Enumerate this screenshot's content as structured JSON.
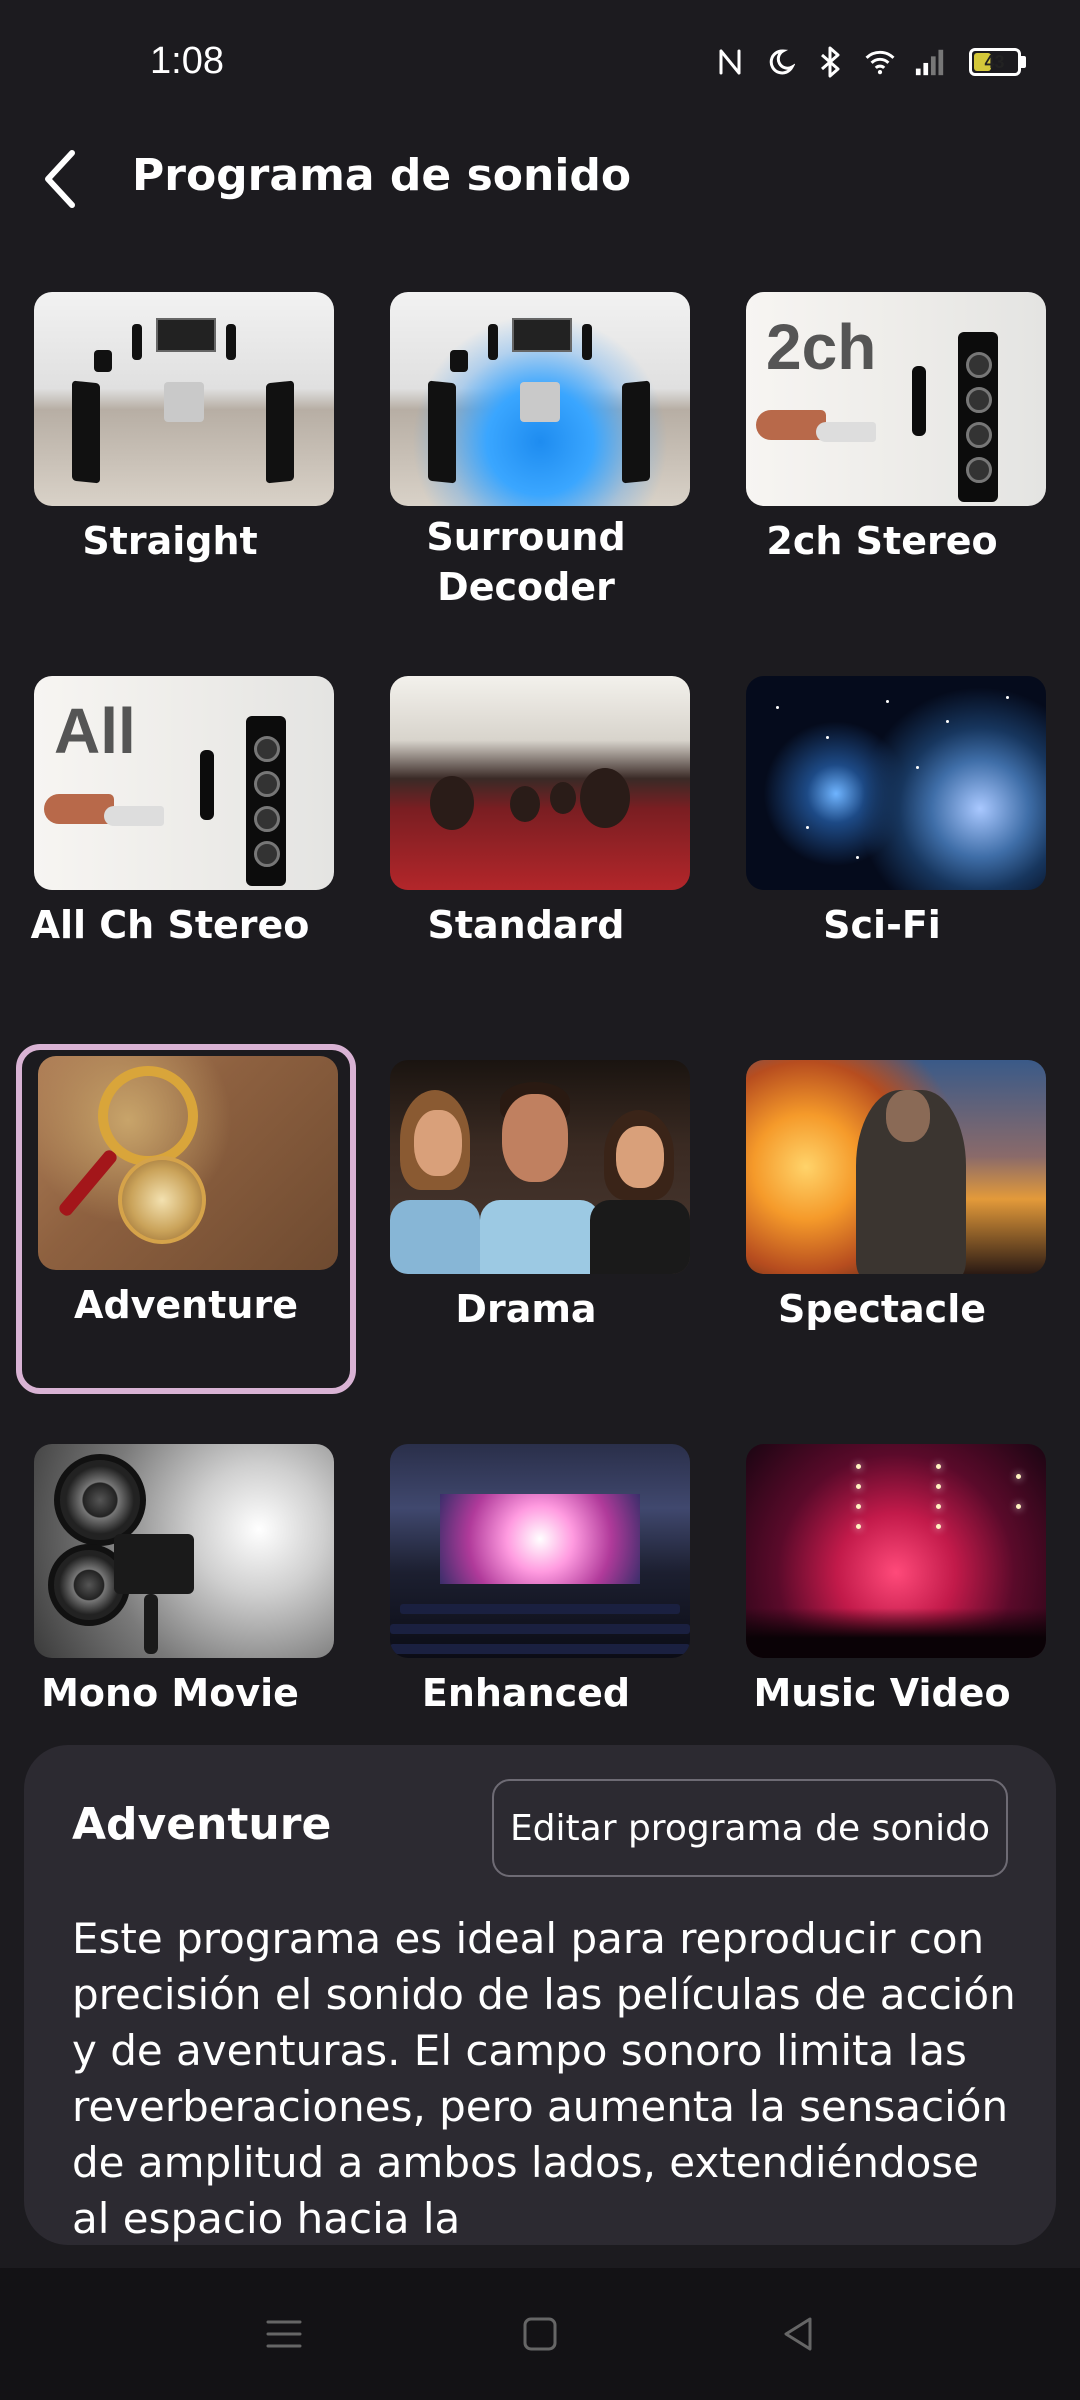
{
  "status_bar": {
    "time": "1:08",
    "battery": "43",
    "icons": [
      "nfc-icon",
      "moon-icon",
      "bluetooth-icon",
      "wifi-icon",
      "signal-icon",
      "battery-icon"
    ]
  },
  "header": {
    "title": "Programa de sonido",
    "back_icon": "chevron-left-icon"
  },
  "programs": [
    {
      "label": "Straight"
    },
    {
      "label": "Surround Decoder"
    },
    {
      "label": "2ch Stereo",
      "thumb_text": "2ch"
    },
    {
      "label": "All Ch Stereo",
      "thumb_text": "All"
    },
    {
      "label": "Standard"
    },
    {
      "label": "Sci-Fi"
    },
    {
      "label": "Adventure",
      "selected": true
    },
    {
      "label": "Drama"
    },
    {
      "label": "Spectacle"
    },
    {
      "label": "Mono Movie"
    },
    {
      "label": "Enhanced"
    },
    {
      "label": "Music Video"
    }
  ],
  "selected_program": {
    "title": "Adventure",
    "edit_button": "Editar programa de sonido",
    "description": "Este programa es ideal para reproducir con precisión el sonido de las películas de acción y de aventuras. El campo sonoro limita las reverberaciones, pero aumenta la sensación de amplitud a ambos lados, extendiéndose al espacio hacia la"
  },
  "colors": {
    "background": "#1c1b1f",
    "selection_border": "#d9b3d4",
    "sheet": "#2c2a31"
  }
}
